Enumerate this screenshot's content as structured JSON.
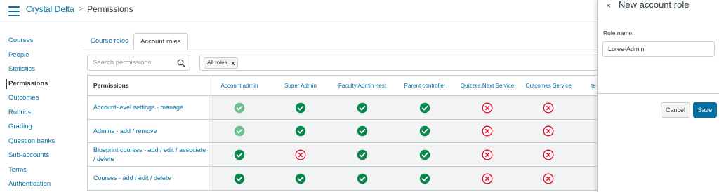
{
  "header": {
    "breadcrumbs": [
      "Crystal Delta",
      "Permissions"
    ],
    "separator": ">"
  },
  "sidebar": {
    "items": [
      {
        "label": "Courses",
        "active": false
      },
      {
        "label": "People",
        "active": false
      },
      {
        "label": "Statistics",
        "active": false
      },
      {
        "label": "Permissions",
        "active": true
      },
      {
        "label": "Outcomes",
        "active": false
      },
      {
        "label": "Rubrics",
        "active": false
      },
      {
        "label": "Grading",
        "active": false
      },
      {
        "label": "Question banks",
        "active": false
      },
      {
        "label": "Sub-accounts",
        "active": false
      },
      {
        "label": "Terms",
        "active": false
      },
      {
        "label": "Authentication",
        "active": false
      }
    ]
  },
  "tabs": [
    "Course roles",
    "Account roles"
  ],
  "search": {
    "placeholder": "Search permissions",
    "value": ""
  },
  "filter": {
    "chip_label": "All roles",
    "chip_remove": "x"
  },
  "table": {
    "permissions_header": "Permissions",
    "columns": [
      "Account admin",
      "Super Admin",
      "Faculty Admin -test",
      "Parent controller",
      "Quizzes.Next Service",
      "Outcomes Service",
      "te"
    ],
    "rows": [
      {
        "label": "Account-level settings - manage",
        "cells": [
          "locked-enabled",
          "enabled",
          "enabled",
          "enabled",
          "disabled",
          "disabled"
        ]
      },
      {
        "label": "Admins - add / remove",
        "cells": [
          "locked-enabled",
          "enabled",
          "enabled",
          "enabled",
          "disabled",
          "disabled"
        ]
      },
      {
        "label": "Blueprint courses - add / edit / associate / delete",
        "cells": [
          "enabled",
          "disabled",
          "enabled",
          "enabled",
          "disabled",
          "disabled"
        ]
      },
      {
        "label": "Courses - add / edit / delete",
        "cells": [
          "enabled",
          "enabled",
          "enabled",
          "enabled",
          "disabled",
          "disabled"
        ]
      }
    ]
  },
  "colors": {
    "enabled": "#0b874b",
    "locked_enabled": "#6cc28f",
    "disabled": "#e0061f",
    "link": "#0770a3",
    "primary_button": "#0770a3"
  },
  "panel": {
    "title": "New account role",
    "close": "×",
    "role_name_label": "Role name:",
    "role_name_value": "Loree-Admin",
    "cancel_label": "Cancel",
    "save_label": "Save"
  }
}
